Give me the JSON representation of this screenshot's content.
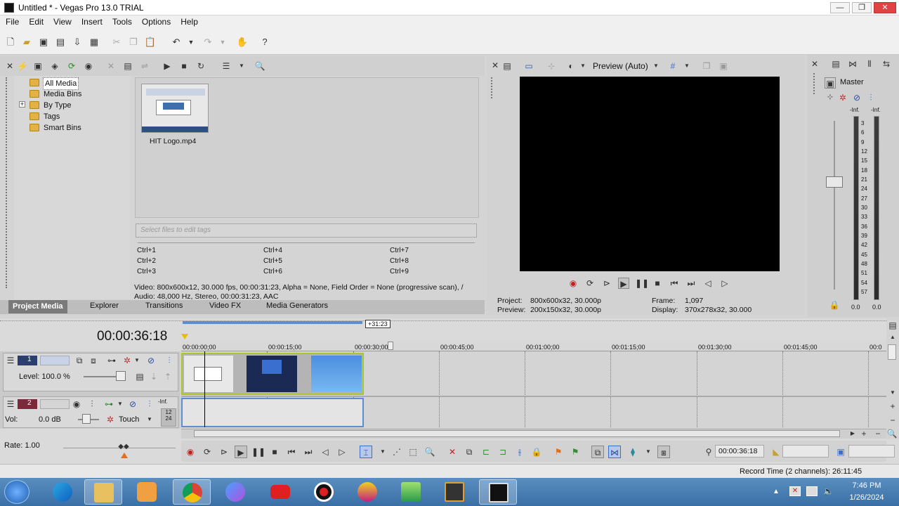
{
  "window": {
    "title": "Untitled * - Vegas Pro 13.0 TRIAL",
    "min": "—",
    "max": "❐",
    "close": "✕"
  },
  "menu": [
    "File",
    "Edit",
    "View",
    "Insert",
    "Tools",
    "Options",
    "Help"
  ],
  "tree": [
    {
      "label": "All Media",
      "selected": true
    },
    {
      "label": "Media Bins"
    },
    {
      "label": "By Type",
      "expander": "+"
    },
    {
      "label": "Tags"
    },
    {
      "label": "Smart Bins"
    }
  ],
  "media": {
    "file_name": "HIT Logo.mp4"
  },
  "tags": {
    "placeholder": "Select files to edit tags"
  },
  "shortcuts": [
    "Ctrl+1",
    "Ctrl+4",
    "Ctrl+7",
    "Ctrl+2",
    "Ctrl+5",
    "Ctrl+8",
    "Ctrl+3",
    "Ctrl+6",
    "Ctrl+9"
  ],
  "media_info": {
    "video": "Video: 800x600x12, 30.000 fps, 00:00:31:23, Alpha = None, Field Order = None (progressive scan), /",
    "audio": "Audio: 48,000 Hz, Stereo, 00:00:31:23, AAC"
  },
  "tabs": [
    "Project Media",
    "Explorer",
    "Transitions",
    "Video FX",
    "Media Generators"
  ],
  "preview": {
    "mode": "Preview (Auto)",
    "project_label": "Project:",
    "project_value": "800x600x32, 30.000p",
    "preview_label": "Preview:",
    "preview_value": "200x150x32, 30.000p",
    "frame_label": "Frame:",
    "frame_value": "1,097",
    "display_label": "Display:",
    "display_value": "370x278x32, 30.000"
  },
  "master": {
    "title": "Master",
    "peak_left": "-Inf.",
    "peak_right": "-Inf.",
    "db_scale": [
      "3",
      "6",
      "9",
      "12",
      "15",
      "18",
      "21",
      "24",
      "27",
      "30",
      "33",
      "36",
      "39",
      "42",
      "45",
      "48",
      "51",
      "54",
      "57"
    ],
    "level_left": "0.0",
    "level_right": "0.0"
  },
  "timeline": {
    "timecode": "00:00:36:18",
    "region_len": "+31:23",
    "ruler": [
      "00:00:00;00",
      "00:00:15;00",
      "00:00:30;00",
      "00:00:45;00",
      "00:01:00;00",
      "00:01:15;00",
      "00:01:30;00",
      "00:01:45;00",
      "00:0"
    ]
  },
  "tracks": {
    "video": {
      "number": "1",
      "level_label": "Level: 100.0 %"
    },
    "audio": {
      "number": "2",
      "vol_label": "Vol:",
      "vol_value": "0.0 dB",
      "mode": "Touch",
      "peak": "-Inf.",
      "meter_a": "12",
      "meter_b": "24"
    }
  },
  "rate": "Rate: 1.00",
  "transport": {
    "timecode": "00:00:36:18"
  },
  "status": {
    "record_time": "Record Time (2 channels): 26:11:45"
  },
  "clock": {
    "time": "7:46 PM",
    "date": "1/26/2024"
  }
}
